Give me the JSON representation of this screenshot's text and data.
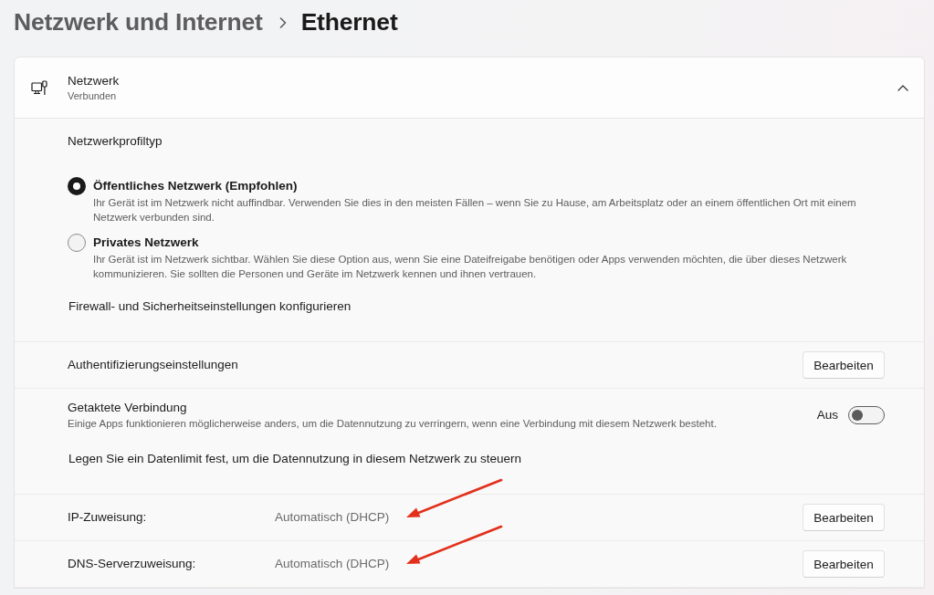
{
  "breadcrumb": [
    {
      "label": "Netzwerk und Internet",
      "current": false
    },
    {
      "label": "Ethernet",
      "current": true
    }
  ],
  "network": {
    "title": "Netzwerk",
    "status": "Verbunden",
    "expanded": true
  },
  "profile": {
    "heading": "Netzwerkprofiltyp",
    "options": [
      {
        "label": "Öffentliches Netzwerk (Empfohlen)",
        "description": "Ihr Gerät ist im Netzwerk nicht auffindbar. Verwenden Sie dies in den meisten Fällen – wenn Sie zu Hause, am Arbeitsplatz oder an einem öffentlichen Ort mit einem Netzwerk verbunden sind.",
        "selected": true
      },
      {
        "label": "Privates Netzwerk",
        "description": "Ihr Gerät ist im Netzwerk sichtbar. Wählen Sie diese Option aus, wenn Sie eine Dateifreigabe benötigen oder Apps verwenden möchten, die über dieses Netzwerk kommunizieren. Sie sollten die Personen und Geräte im Netzwerk kennen und ihnen vertrauen.",
        "selected": false
      }
    ],
    "firewall_link": "Firewall- und Sicherheitseinstellungen konfigurieren"
  },
  "authentication": {
    "label": "Authentifizierungseinstellungen",
    "button": "Bearbeiten"
  },
  "metered": {
    "title": "Getaktete Verbindung",
    "description": "Einige Apps funktionieren möglicherweise anders, um die Datennutzung zu verringern, wenn eine Verbindung mit diesem Netzwerk besteht.",
    "state_label": "Aus",
    "on": false,
    "data_limit_link": "Legen Sie ein Datenlimit fest, um die Datennutzung in diesem Netzwerk zu steuern"
  },
  "assignments": [
    {
      "label": "IP-Zuweisung:",
      "value": "Automatisch (DHCP)",
      "button": "Bearbeiten",
      "annotated": true
    },
    {
      "label": "DNS-Serverzuweisung:",
      "value": "Automatisch (DHCP)",
      "button": "Bearbeiten",
      "annotated": true
    }
  ]
}
